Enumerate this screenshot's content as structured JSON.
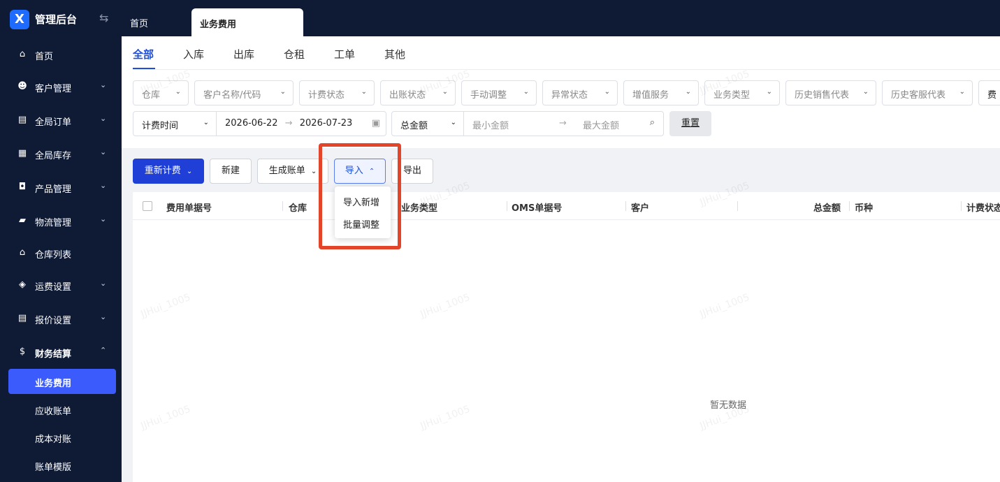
{
  "app": {
    "title": "管理后台",
    "logo_text": "X"
  },
  "top_tabs": [
    {
      "label": "首页"
    },
    {
      "label": "业务费用"
    }
  ],
  "sidebar": {
    "items": [
      {
        "label": "首页",
        "icon": "home-icon"
      },
      {
        "label": "客户管理",
        "icon": "users-icon"
      },
      {
        "label": "全局订单",
        "icon": "clipboard-icon"
      },
      {
        "label": "全局库存",
        "icon": "warehouse-icon"
      },
      {
        "label": "产品管理",
        "icon": "bag-icon"
      },
      {
        "label": "物流管理",
        "icon": "truck-icon"
      },
      {
        "label": "仓库列表",
        "icon": "store-icon"
      },
      {
        "label": "运费设置",
        "icon": "box-icon"
      },
      {
        "label": "报价设置",
        "icon": "document-icon"
      },
      {
        "label": "财务结算",
        "icon": "dollar-icon"
      }
    ],
    "sub_items": [
      {
        "label": "业务费用"
      },
      {
        "label": "应收账单"
      },
      {
        "label": "成本对账"
      },
      {
        "label": "账单模版"
      }
    ]
  },
  "content_tabs": [
    "全部",
    "入库",
    "出库",
    "仓租",
    "工单",
    "其他"
  ],
  "filters": [
    "仓库",
    "客户名称/代码",
    "计费状态",
    "出账状态",
    "手动调整",
    "异常状态",
    "增值服务",
    "业务类型",
    "历史销售代表",
    "历史客服代表",
    "费"
  ],
  "filter_row2": {
    "time_type": "计费时间",
    "date_start": "2026-06-22",
    "date_end": "2026-07-23",
    "amount_type": "总金额",
    "min_placeholder": "最小金额",
    "max_placeholder": "最大金额",
    "reset_label": "重置"
  },
  "toolbar": {
    "recalc_label": "重新计费",
    "new_label": "新建",
    "generate_label": "生成账单",
    "import_label": "导入",
    "export_label": "导出"
  },
  "import_menu": [
    "导入新增",
    "批量调整"
  ],
  "table": {
    "columns": [
      "费用单据号",
      "仓库",
      "业务类型",
      "OMS单据号",
      "客户",
      "总金额",
      "币种",
      "计费状态"
    ],
    "empty_text": "暂无数据"
  },
  "watermark": "JJHui_1005",
  "colors": {
    "nav_bg": "#0f1b35",
    "accent": "#1f3fd6",
    "highlight": "#e2452a"
  }
}
